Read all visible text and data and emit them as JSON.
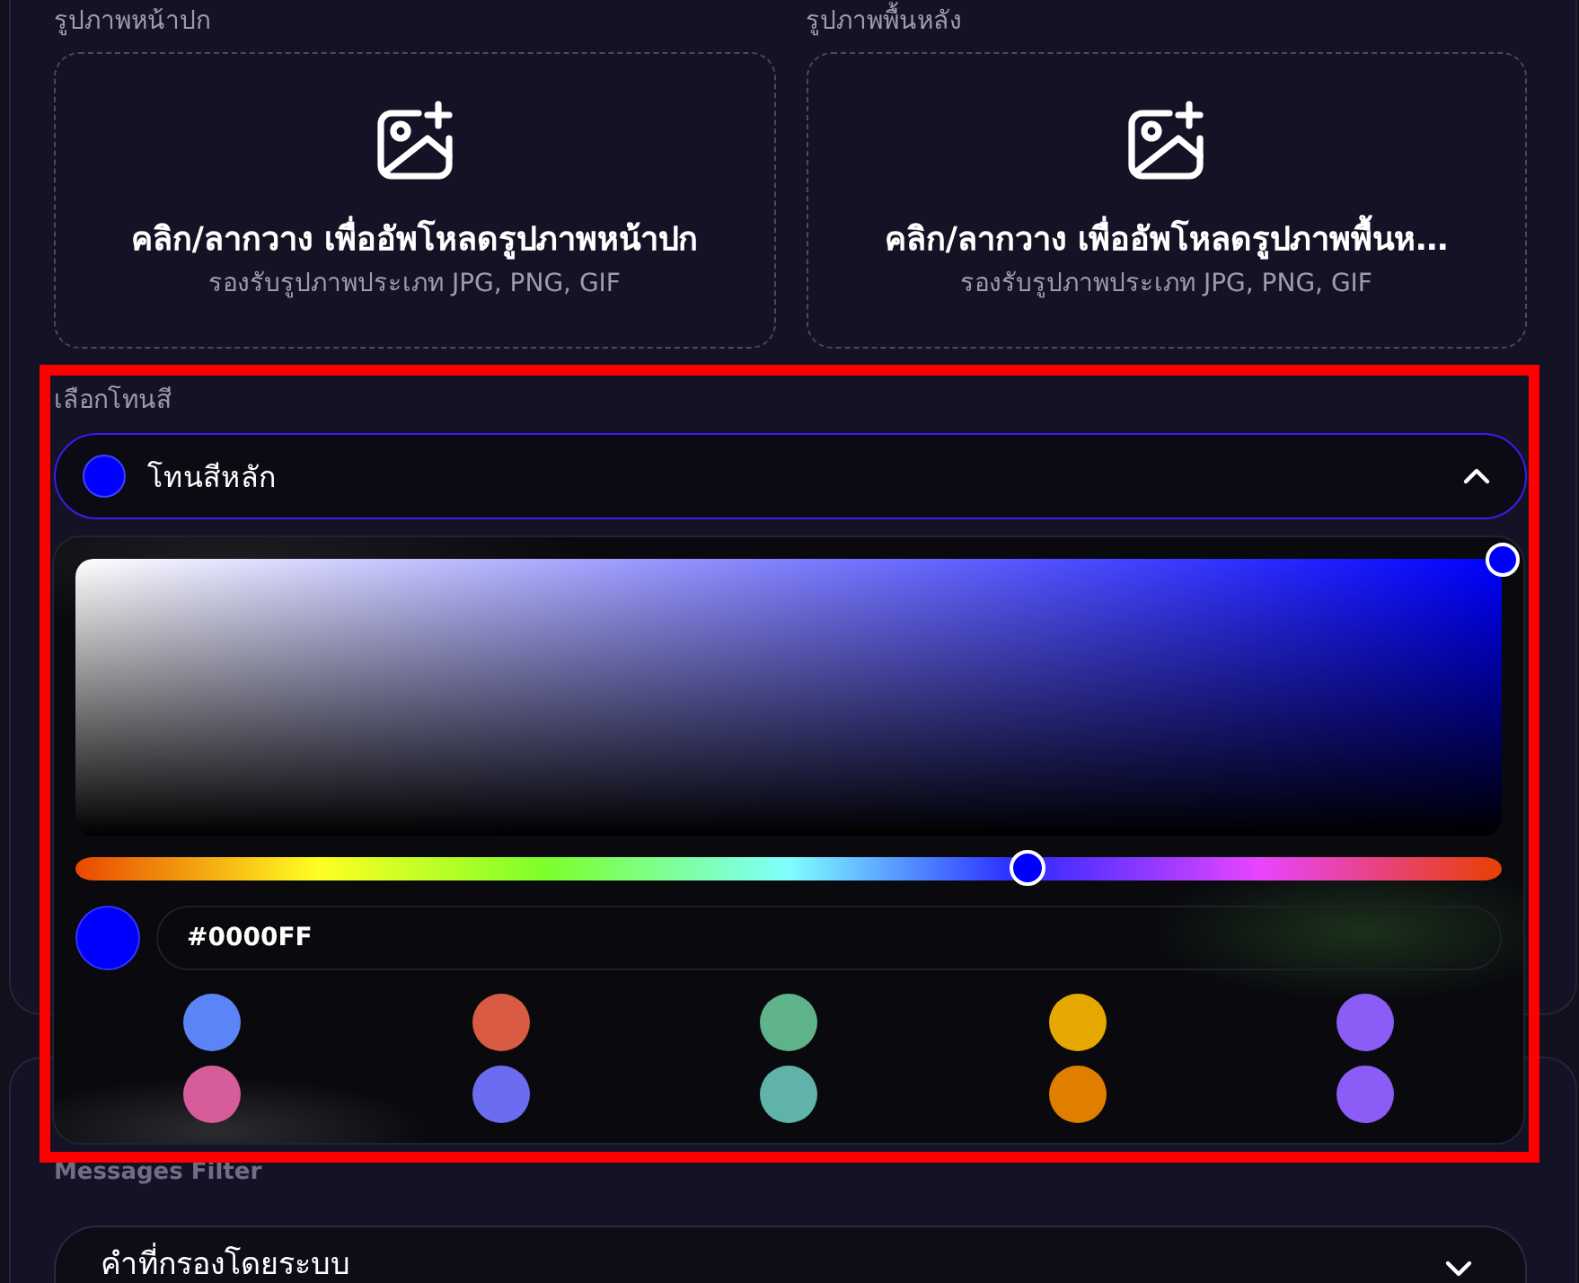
{
  "uploads": [
    {
      "label": "รูปภาพหน้าปก",
      "title": "คลิก/ลากวาง เพื่ออัพโหลดรูปภาพหน้าปก",
      "hint": "รองรับรูปภาพประเภท JPG, PNG, GIF"
    },
    {
      "label": "รูปภาพพื้นหลัง",
      "title": "คลิก/ลากวาง เพื่ออัพโหลดรูปภาพพื้นห…",
      "hint": "รองรับรูปภาพประเภท JPG, PNG, GIF"
    }
  ],
  "color_tone": {
    "label": "เลือกโทนสี",
    "value": "โทนสีหลัก",
    "expanded": true,
    "picker": {
      "hue": {
        "level": 0.667
      },
      "hex_input": {
        "value": "#0000FF"
      },
      "presets": [
        {
          "color": "#5b85f7",
          "selected": false
        },
        {
          "color": "#d95b43",
          "selected": false
        },
        {
          "color": "#5fb38a",
          "selected": false
        },
        {
          "color": "#e5a800",
          "selected": false
        },
        {
          "color": "#8b5cf6",
          "selected": false
        },
        {
          "color": "#d65c9a",
          "selected": false
        },
        {
          "color": "#6c6cf0",
          "selected": false
        },
        {
          "color": "#5fb3a8",
          "selected": false
        },
        {
          "color": "#e07e00",
          "selected": false
        },
        {
          "color": "#8b5cf6",
          "selected": false
        }
      ]
    }
  },
  "messages_filter": {
    "label": "Messages Filter",
    "value": "คำที่กรองโดยระบบ",
    "expanded": false
  }
}
